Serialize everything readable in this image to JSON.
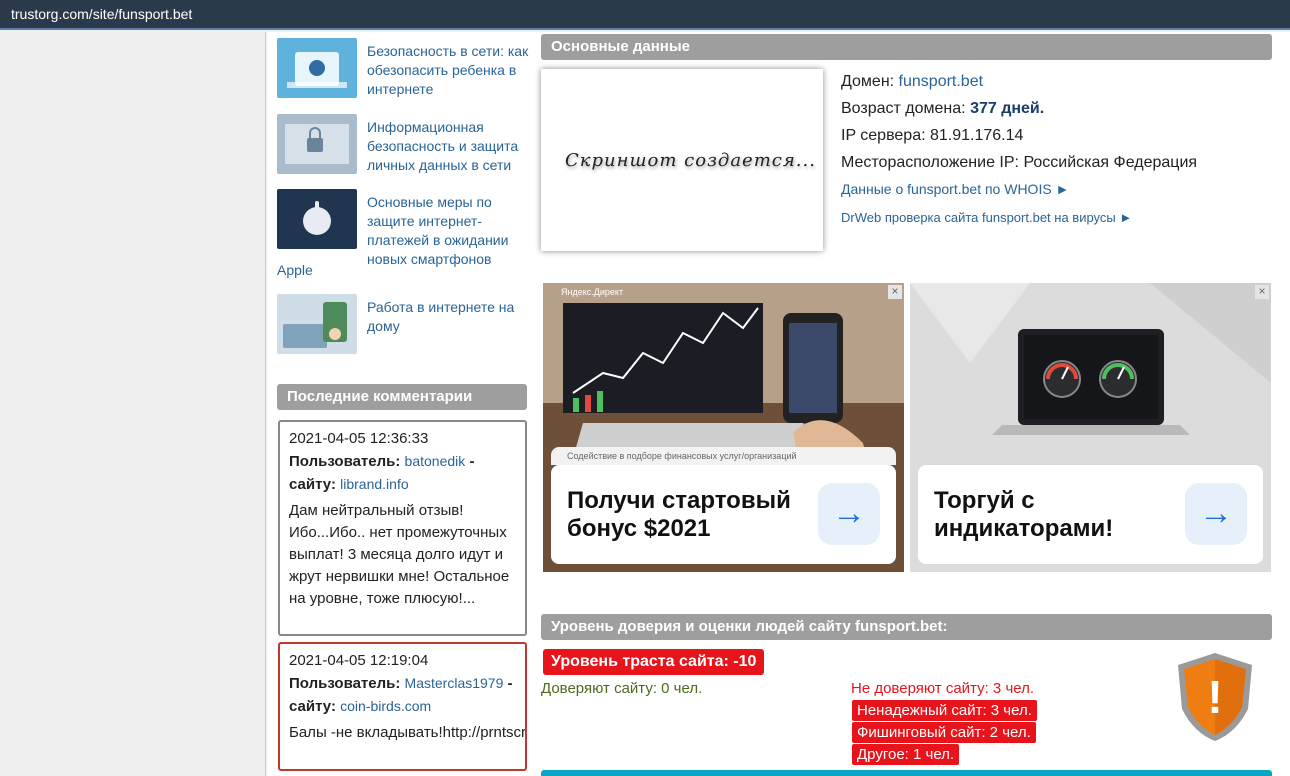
{
  "browser": {
    "url": "trustorg.com/site/funsport.bet"
  },
  "sidebar": {
    "articles": [
      {
        "title": "Безопасность в сети: как обезопасить ребенка в интернете",
        "tail": ""
      },
      {
        "title": "Информационная безопасность и защита личных данных в сети",
        "tail": ""
      },
      {
        "title": "Основные меры по защите интернет-платежей в ожидании новых смартфонов",
        "tail": "Apple"
      },
      {
        "title": "Работа в интернете на дому",
        "tail": ""
      }
    ],
    "comments_heading": "Последние комментарии",
    "comments": [
      {
        "date": "2021-04-05 12:36:33",
        "user_label": "Пользователь:",
        "user": "batonedik",
        "site_label": "- сайту:",
        "site": "librand.info",
        "text": "Дам нейтральный отзыв! Ибо...Ибо.. нет промежуточных выплат! 3 месяца долго идут и жрут нервишки мне! Остальное на уровне, тоже плюсую!..."
      },
      {
        "date": "2021-04-05 12:19:04",
        "user_label": "Пользователь:",
        "user": "Masterclas1979",
        "site_label": "- сайту:",
        "site": "coin-birds.com",
        "text": "Балы -не вкладывать!http://prntscr.com/"
      }
    ]
  },
  "main": {
    "basic_heading": "Основные данные",
    "screenshot_placeholder": "Скриншот создается...",
    "domain_label": "Домен:",
    "domain": "funsport.bet",
    "age_label": "Возраст домена:",
    "age": "377 дней.",
    "ip_label": "IP сервера:",
    "ip": "81.91.176.14",
    "location_label": "Месторасположение IP:",
    "location": "Российская Федерация",
    "whois_link": "Данные о funsport.bet по WHOIS ►",
    "drweb_link": "DrWeb проверка сайта funsport.bet на вирусы ►"
  },
  "ads": [
    {
      "label": "Яндекс.Директ",
      "subtitle": "Содействие в подборе финансовых услуг/организаций",
      "headline": "Получи стартовый бонус $2021",
      "close": "×",
      "arrow": "→"
    },
    {
      "label": "",
      "subtitle": "",
      "headline": "Торгуй с индикаторами!",
      "close": "×",
      "arrow": "→"
    }
  ],
  "trust": {
    "heading": "Уровень доверия и оценки людей сайту funsport.bet:",
    "level": "Уровень траста сайта: -10",
    "trust_count": "Доверяют сайту: 0 чел.",
    "distrust_count": "Не доверяют сайту: 3 чел.",
    "reasons": [
      "Ненадежный сайт: 3 чел.",
      "Фишинговый сайт: 2 чел.",
      "Другое: 1 чел."
    ],
    "shield_symbol": "!"
  },
  "colors": {
    "link": "#2a6496",
    "heading_bg": "#9e9e9e",
    "danger": "#e8141b",
    "trust_green": "#4b6b1f",
    "shield_orange": "#f07d12"
  }
}
